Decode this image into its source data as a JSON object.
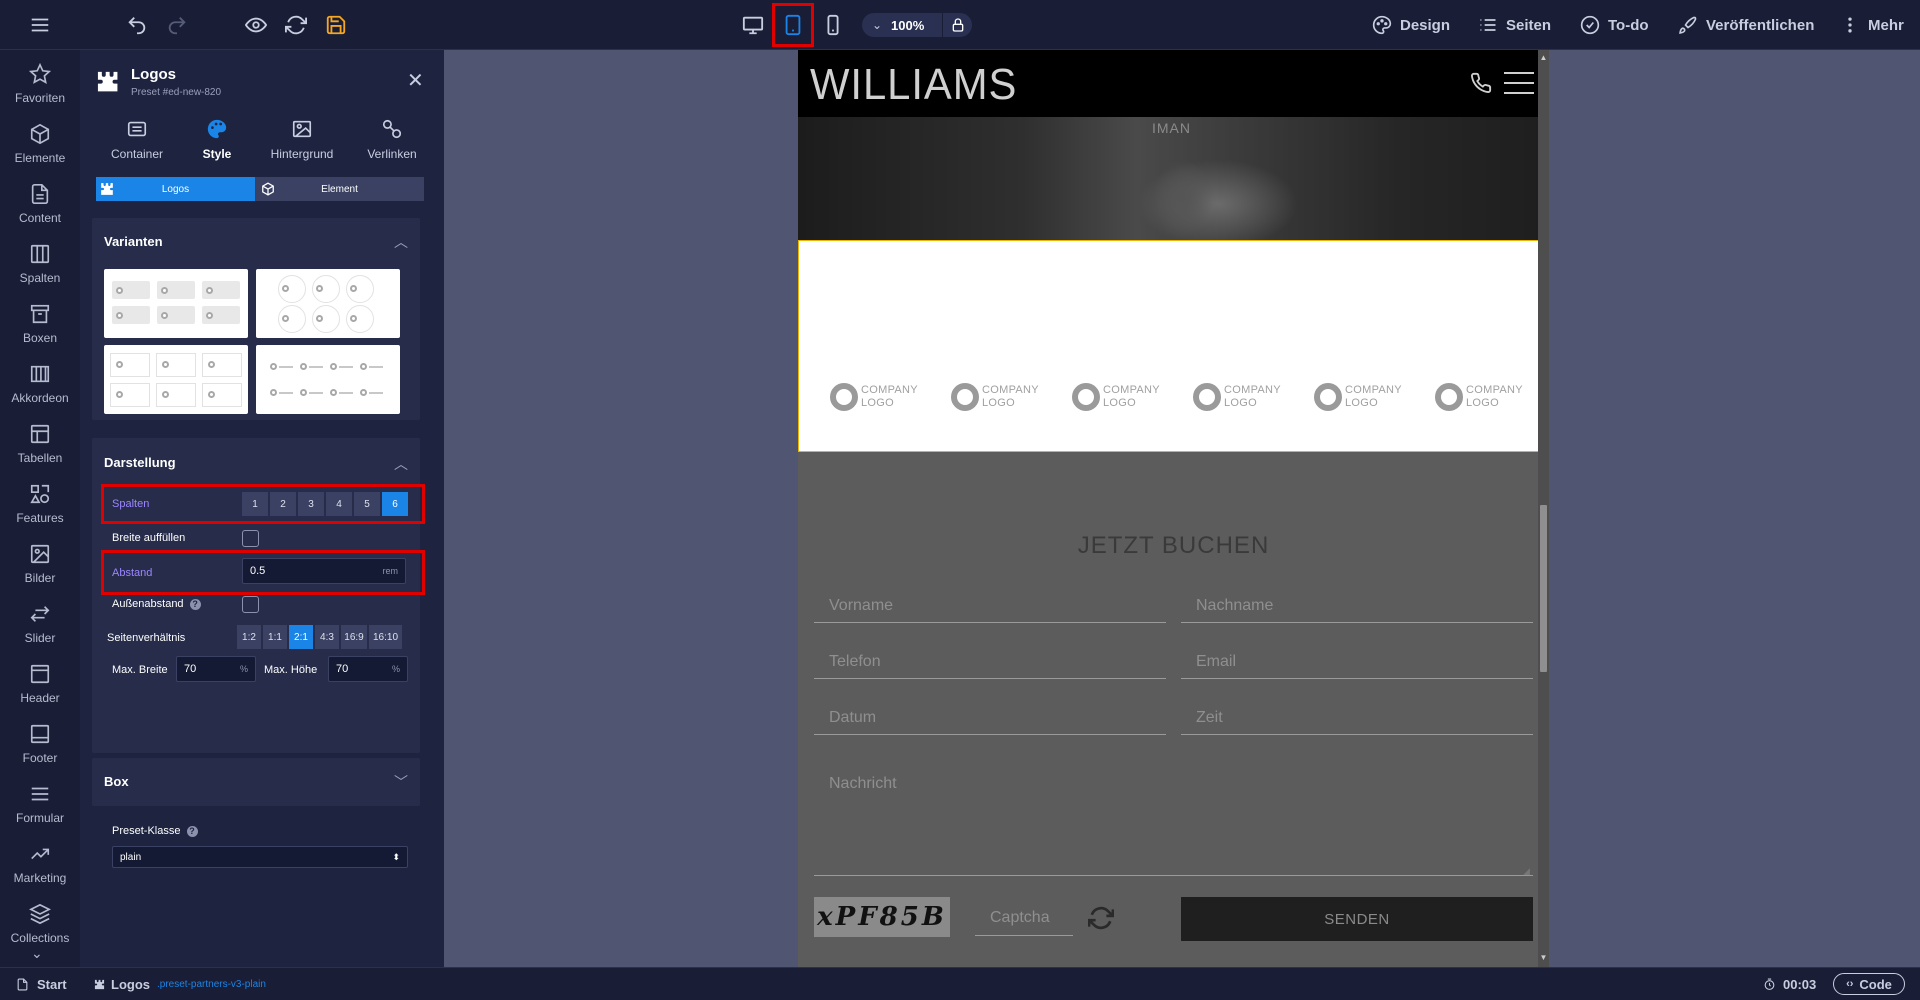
{
  "topbar": {
    "zoom": "100%",
    "nav": {
      "design": "Design",
      "pages": "Seiten",
      "todo": "To-do",
      "publish": "Veröffentlichen",
      "more": "Mehr"
    }
  },
  "rail": [
    "Favoriten",
    "Elemente",
    "Content",
    "Spalten",
    "Boxen",
    "Akkordeon",
    "Tabellen",
    "Features",
    "Bilder",
    "Slider",
    "Header",
    "Footer",
    "Formular",
    "Marketing",
    "Collections"
  ],
  "panel": {
    "title": "Logos",
    "preset": "Preset #ed-new-820",
    "tabs": [
      "Container",
      "Style",
      "Hintergrund",
      "Verlinken"
    ],
    "active_tab": "Style",
    "seg": {
      "left": "Logos",
      "right": "Element"
    },
    "variants_title": "Varianten",
    "display_title": "Darstellung",
    "columns_label": "Spalten",
    "columns_options": [
      "1",
      "2",
      "3",
      "4",
      "5",
      "6"
    ],
    "columns_selected": "6",
    "fill_width_label": "Breite auffüllen",
    "spacing_label": "Abstand",
    "spacing_value": "0.5",
    "spacing_unit": "rem",
    "outer_spacing_label": "Außenabstand",
    "aspect_label": "Seitenverhältnis",
    "aspect_options": [
      "1:2",
      "1:1",
      "2:1",
      "4:3",
      "16:9",
      "16:10"
    ],
    "aspect_selected": "2:1",
    "max_width_label": "Max. Breite",
    "max_width_value": "70",
    "max_width_unit": "%",
    "max_height_label": "Max. Höhe",
    "max_height_value": "70",
    "max_height_unit": "%",
    "box_title": "Box",
    "preset_class_label": "Preset-Klasse",
    "preset_class_value": "plain"
  },
  "site": {
    "brand": "WILLIAMS",
    "hero_text": "IMAN",
    "logo_line1": "COMPANY",
    "logo_line2": "LOGO",
    "form_title": "JETZT BUCHEN",
    "fields": {
      "firstname": "Vorname",
      "lastname": "Nachname",
      "phone": "Telefon",
      "email": "Email",
      "date": "Datum",
      "time": "Zeit",
      "message": "Nachricht",
      "captcha": "Captcha"
    },
    "captcha_image_text": "xPF85B",
    "submit": "SENDEN"
  },
  "statusbar": {
    "start": "Start",
    "crumb": "Logos",
    "crumb_class": ".preset-partners-v3-plain",
    "timer": "00:03",
    "code": "Code"
  },
  "colors": {
    "accent": "#1b84e7",
    "highlight": "#e00000",
    "section_border": "#f0b400",
    "label_purple": "#9c86ff"
  }
}
